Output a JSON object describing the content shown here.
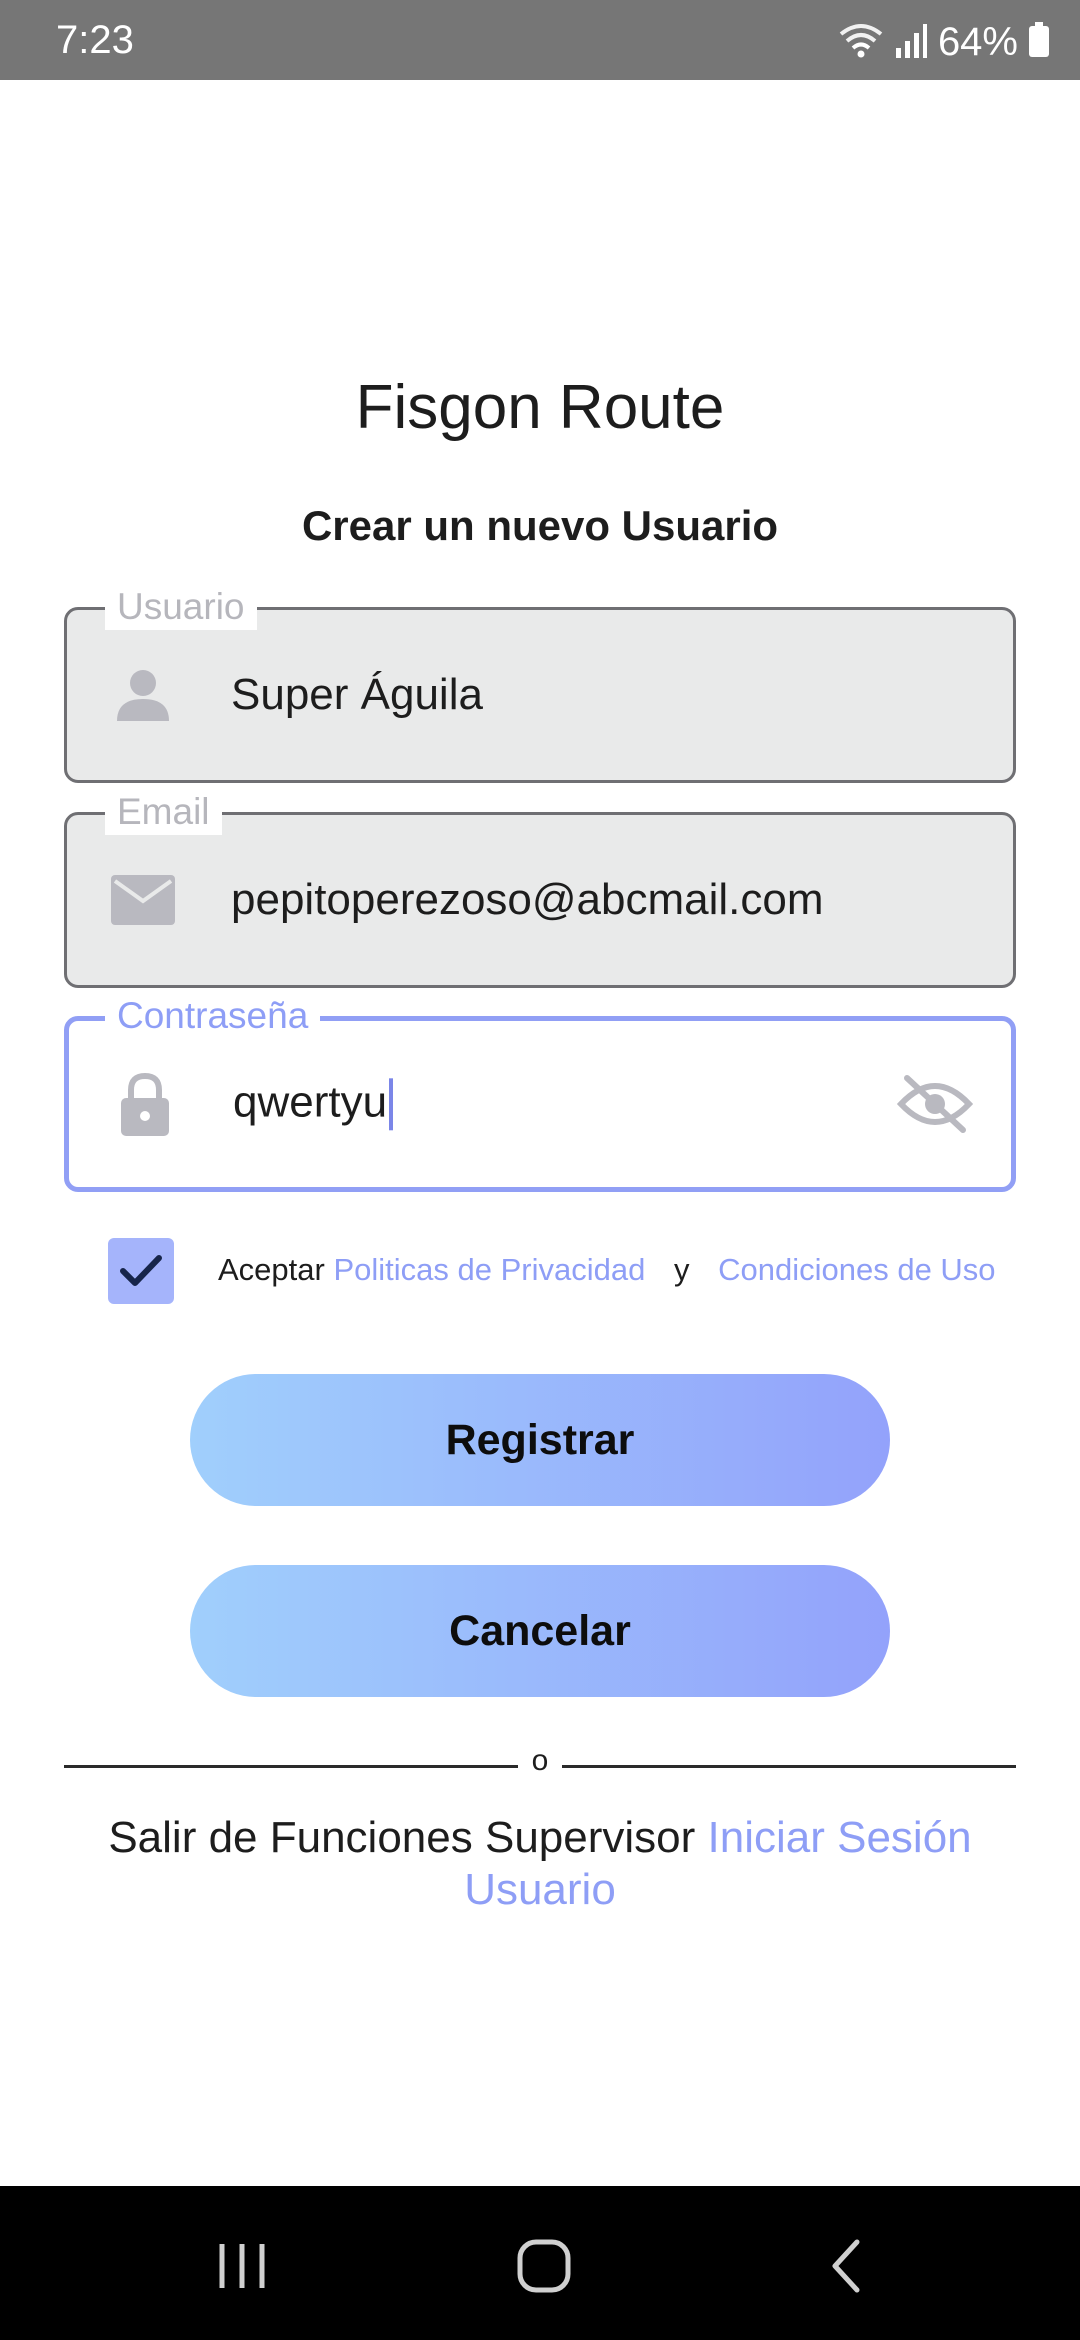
{
  "status_bar": {
    "time": "7:23",
    "battery": "64%",
    "icons": [
      "wifi-icon",
      "signal-icon",
      "battery-icon"
    ]
  },
  "app": {
    "title": "Fisgon Route",
    "subtitle": "Crear un nuevo Usuario"
  },
  "form": {
    "username": {
      "label": "Usuario",
      "value": "Super Águila",
      "icon": "person-icon"
    },
    "email": {
      "label": "Email",
      "value": "pepitoperezoso@abcmail.com",
      "icon": "mail-icon"
    },
    "password": {
      "label": "Contraseña",
      "value": "qwertyu",
      "icon": "lock-icon",
      "toggle_icon": "eye-off-icon"
    }
  },
  "terms": {
    "checked": true,
    "prefix": "Aceptar",
    "privacy_link": "Politicas de Privacidad",
    "conjunction": "y",
    "terms_link": "Condiciones de Uso"
  },
  "buttons": {
    "register": "Registrar",
    "cancel": "Cancelar"
  },
  "divider": {
    "text": "o"
  },
  "footer": {
    "text": "Salir de Funciones Supervisor",
    "link": "Iniciar Sesión Usuario"
  },
  "nav_bar": {
    "icons": [
      "recent-apps-icon",
      "home-icon",
      "back-icon"
    ]
  },
  "colors": {
    "accent": "#8e9ef6",
    "button_gradient_start": "#a0cffc",
    "button_gradient_end": "#93a2fb",
    "status_bar": "#767676",
    "nav_bar": "#000000"
  }
}
